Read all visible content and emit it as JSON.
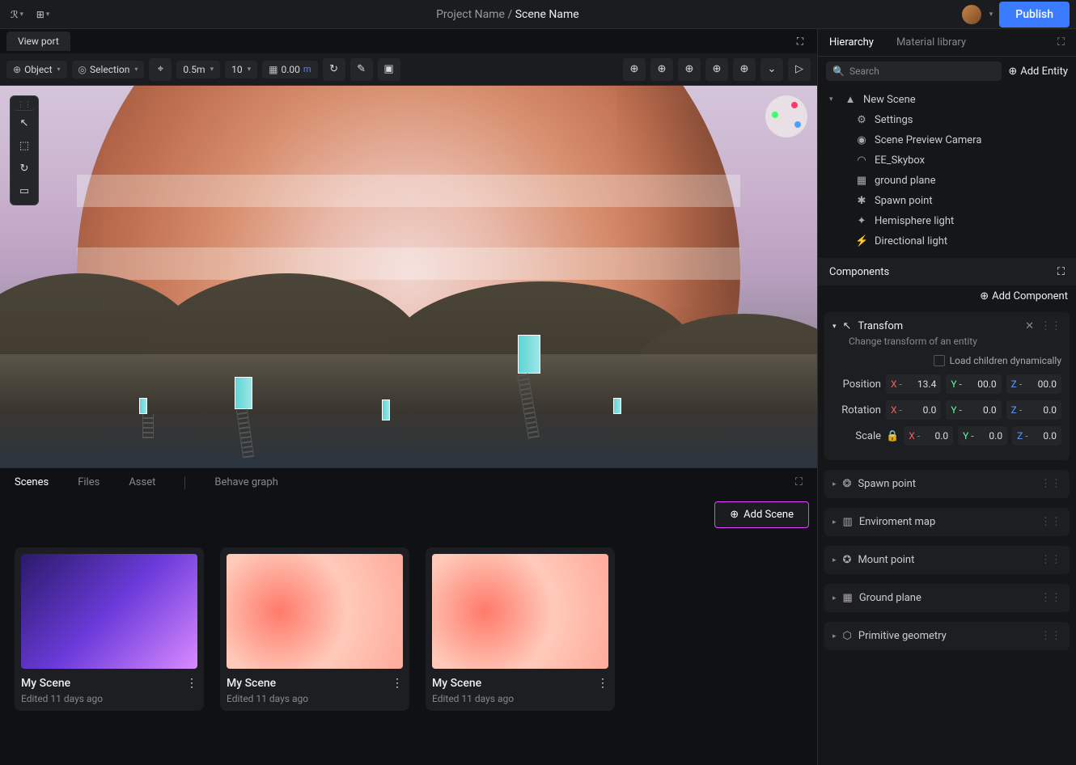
{
  "breadcrumb": {
    "project": "Project Name",
    "scene": "Scene Name"
  },
  "publish_label": "Publish",
  "viewport_tab": "View port",
  "toolbar": {
    "object_label": "Object",
    "selection_label": "Selection",
    "snap_dist": "0.5m",
    "snap_angle": "10",
    "grid_val": "0.00",
    "grid_unit": "m"
  },
  "bottom_tabs": {
    "scenes": "Scenes",
    "files": "Files",
    "asset": "Asset",
    "behave": "Behave graph"
  },
  "add_scene_label": "Add Scene",
  "scenes": [
    {
      "title": "My Scene",
      "edited": "Edited 11 days ago"
    },
    {
      "title": "My Scene",
      "edited": "Edited 11 days ago"
    },
    {
      "title": "My Scene",
      "edited": "Edited 11 days ago"
    }
  ],
  "right": {
    "hierarchy_tab": "Hierarchy",
    "material_tab": "Material library",
    "search_placeholder": "Search",
    "add_entity_label": "Add Entity",
    "root": "New Scene",
    "tree": [
      {
        "icon": "⚙",
        "label": "Settings"
      },
      {
        "icon": "◉",
        "label": "Scene Preview Camera"
      },
      {
        "icon": "◠",
        "label": "EE_Skybox"
      },
      {
        "icon": "▦",
        "label": "ground plane"
      },
      {
        "icon": "✱",
        "label": "Spawn point"
      },
      {
        "icon": "✦",
        "label": "Hemisphere light"
      },
      {
        "icon": "⚡",
        "label": "Directional light"
      }
    ],
    "components_header": "Components",
    "add_component_label": "Add Component",
    "transform": {
      "title": "Transfom",
      "desc": "Change transform of an entity",
      "load_dyn_label": "Load children dynamically",
      "position_label": "Position",
      "rotation_label": "Rotation",
      "scale_label": "Scale",
      "position": {
        "x": "13.4",
        "y": "00.0",
        "z": "00.0"
      },
      "rotation": {
        "x": "0.0",
        "y": "0.0",
        "z": "0.0"
      },
      "scale": {
        "x": "0.0",
        "y": "0.0",
        "z": "0.0"
      }
    },
    "collapsed": [
      {
        "icon": "❂",
        "label": "Spawn point"
      },
      {
        "icon": "▥",
        "label": "Enviroment map"
      },
      {
        "icon": "✪",
        "label": "Mount point"
      },
      {
        "icon": "▦",
        "label": "Ground plane"
      },
      {
        "icon": "⬡",
        "label": "Primitive geometry"
      }
    ]
  }
}
